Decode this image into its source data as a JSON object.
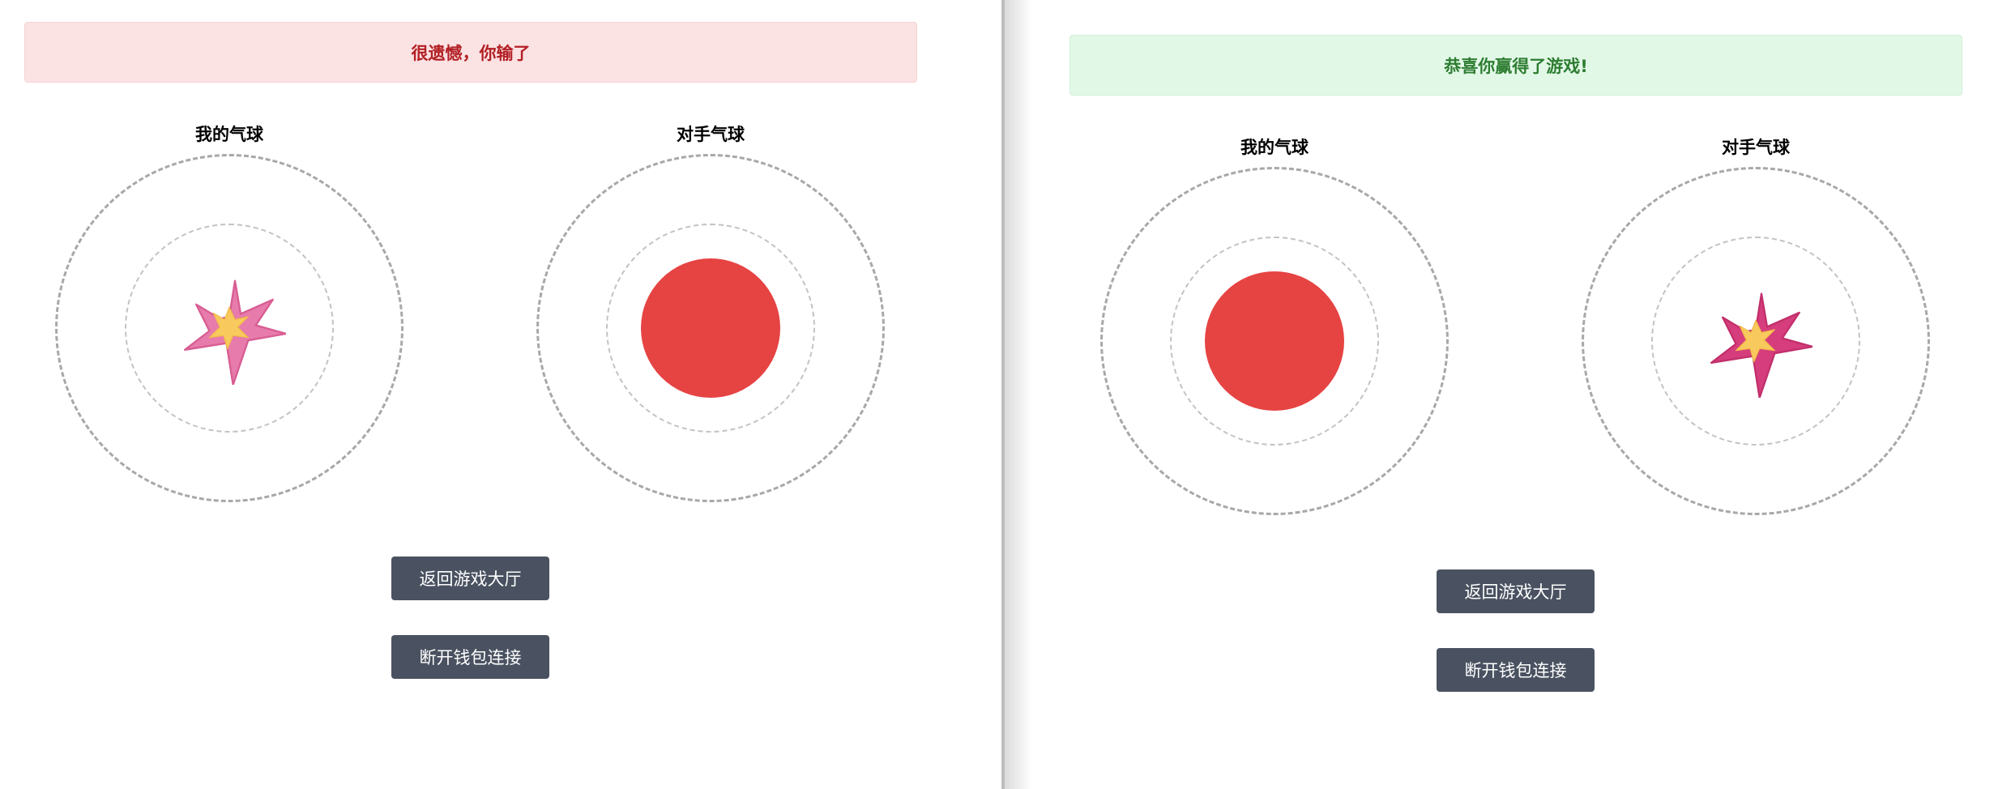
{
  "left_view": {
    "banner_text": "很遗憾，你输了",
    "my_balloon": {
      "label": "我的气球",
      "state": "popped",
      "icon": "burst-icon"
    },
    "opponent_balloon": {
      "label": "对手气球",
      "state": "intact",
      "icon": "balloon-icon"
    },
    "buttons": {
      "back_to_lobby": "返回游戏大厅",
      "disconnect_wallet": "断开钱包连接"
    }
  },
  "right_view": {
    "banner_text": "恭喜你赢得了游戏!",
    "my_balloon": {
      "label": "我的气球",
      "state": "intact",
      "icon": "balloon-icon"
    },
    "opponent_balloon": {
      "label": "对手气球",
      "state": "popped",
      "icon": "burst-icon"
    },
    "buttons": {
      "back_to_lobby": "返回游戏大厅",
      "disconnect_wallet": "断开钱包连接"
    }
  },
  "colors": {
    "lose_banner_bg": "#fbe2e3",
    "lose_text": "#b21f24",
    "win_banner_bg": "#e2f8e7",
    "win_text": "#2e7d32",
    "balloon_red": "#e64343",
    "burst_pink": "#e77bab",
    "burst_magenta": "#d63d7c",
    "burst_yellow": "#f8c95c",
    "button_bg": "#4a5261"
  }
}
